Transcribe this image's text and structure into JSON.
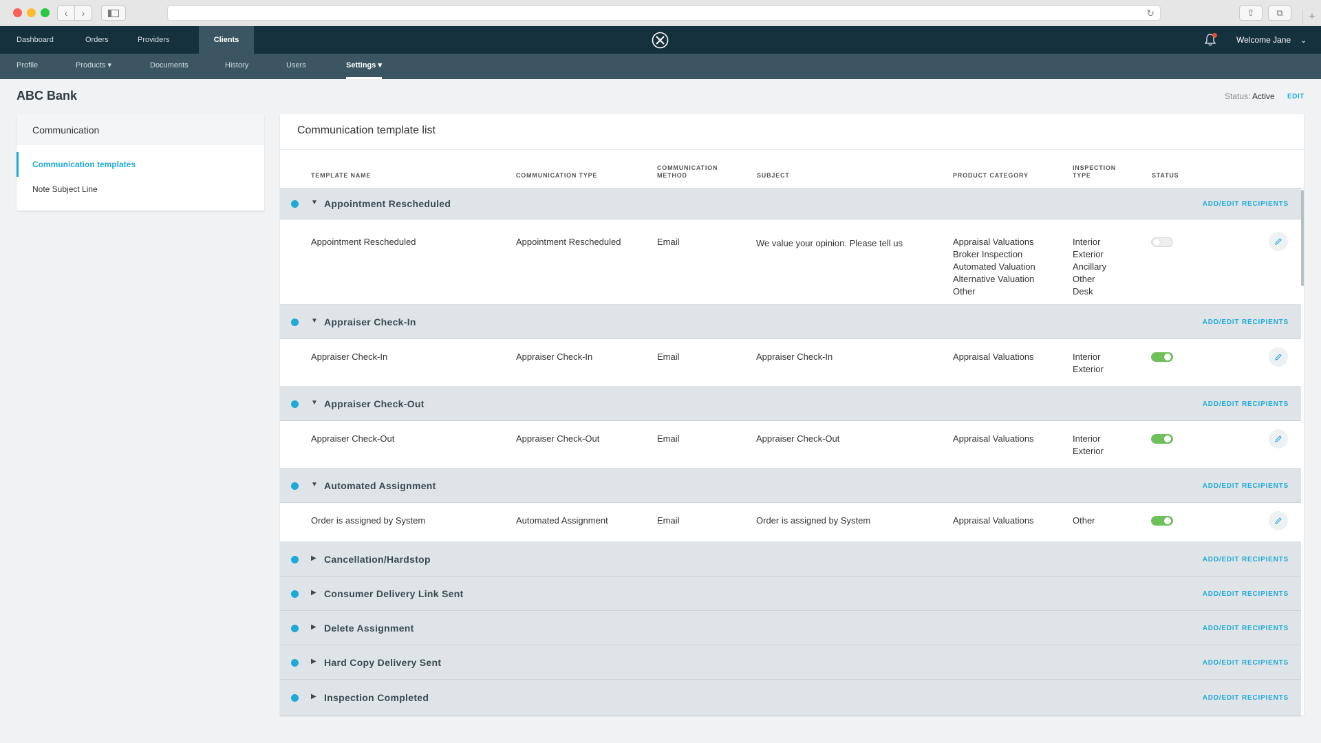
{
  "browser": {
    "address": ""
  },
  "topnav": {
    "items": [
      "Dashboard",
      "Orders",
      "Providers",
      "Clients"
    ],
    "welcome": "Welcome Jane"
  },
  "subnav": {
    "items": [
      "Profile",
      "Products ▾",
      "Documents",
      "History",
      "Users",
      "Settings ▾"
    ]
  },
  "page": {
    "title": "ABC Bank",
    "status_label": "Status:",
    "status_value": "Active",
    "edit": "EDIT"
  },
  "left_panel": {
    "header": "Communication",
    "items": [
      "Communication templates",
      "Note Subject Line"
    ]
  },
  "list": {
    "title": "Communication template list",
    "columns": {
      "template_name": "TEMPLATE NAME",
      "communication_type": "COMMUNICATION TYPE",
      "communication_method_1": "COMMUNICATION",
      "communication_method_2": "METHOD",
      "subject": "SUBJECT",
      "product_category": "PRODUCT CATEGORY",
      "inspection_type_1": "INSPECTION",
      "inspection_type_2": "TYPE",
      "status": "STATUS"
    },
    "add_edit_label": "ADD/EDIT RECIPIENTS",
    "groups": [
      {
        "name": "Appointment Rescheduled",
        "expanded": true,
        "row": {
          "template_name": "Appointment Rescheduled",
          "communication_type": "Appointment Rescheduled",
          "method": "Email",
          "subject": "We value your opinion. Please tell us",
          "product_category": [
            "Appraisal Valuations",
            "Broker Inspection",
            "Automated Valuation",
            "Alternative Valuation",
            "Other"
          ],
          "inspection_type": [
            "Interior",
            "Exterior",
            "Ancillary",
            "Other",
            "Desk"
          ],
          "active": false
        }
      },
      {
        "name": "Appraiser Check-In",
        "expanded": true,
        "row": {
          "template_name": "Appraiser Check-In",
          "communication_type": "Appraiser Check-In",
          "method": "Email",
          "subject": "Appraiser Check-In",
          "product_category": [
            "Appraisal Valuations"
          ],
          "inspection_type": [
            "Interior",
            "Exterior"
          ],
          "active": true
        }
      },
      {
        "name": "Appraiser Check-Out",
        "expanded": true,
        "row": {
          "template_name": "Appraiser Check-Out",
          "communication_type": "Appraiser Check-Out",
          "method": "Email",
          "subject": "Appraiser Check-Out",
          "product_category": [
            "Appraisal Valuations"
          ],
          "inspection_type": [
            "Interior",
            "Exterior"
          ],
          "active": true
        }
      },
      {
        "name": "Automated Assignment",
        "expanded": true,
        "row": {
          "template_name": "Order is assigned by System",
          "communication_type": "Automated Assignment",
          "method": "Email",
          "subject": "Order is assigned by System",
          "product_category": [
            "Appraisal Valuations"
          ],
          "inspection_type": [
            "Other"
          ],
          "active": true
        }
      },
      {
        "name": "Cancellation/Hardstop",
        "expanded": false
      },
      {
        "name": "Consumer Delivery Link Sent",
        "expanded": false
      },
      {
        "name": "Delete Assignment",
        "expanded": false
      },
      {
        "name": "Hard Copy Delivery Sent",
        "expanded": false
      },
      {
        "name": "Inspection Completed",
        "expanded": false
      }
    ]
  },
  "icons": {
    "logo": "x-circle-logo-icon",
    "bell": "bell-icon",
    "edit": "pencil-icon"
  },
  "colors": {
    "nav_dark": "#16313e",
    "nav_sub": "#3b5662",
    "accent": "#1fa9d6",
    "toggle_on": "#6fc05b"
  }
}
